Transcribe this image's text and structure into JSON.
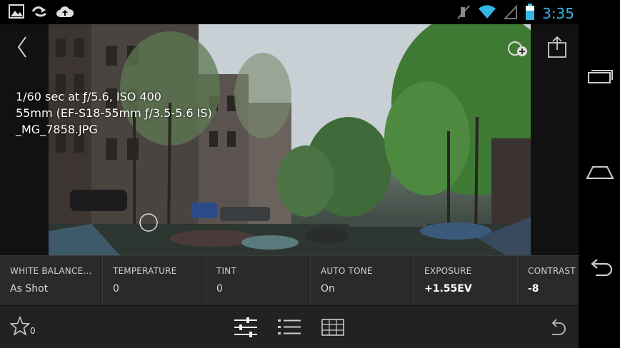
{
  "status_bar": {
    "time": "3:35",
    "left_icons": [
      "image-icon",
      "sync-icon",
      "cloud-upload-icon"
    ],
    "right_icons": [
      "mute-icon",
      "wifi-icon",
      "signal-icon",
      "battery-icon"
    ],
    "time_color": "#33b5e5"
  },
  "photo_info": {
    "exposure_line": "1/60 sec at ƒ/5.6, ISO 400",
    "lens_line": "55mm (EF-S18-55mm ƒ/3.5-5.6 IS)",
    "filename": "_MG_7858.JPG"
  },
  "adjustments": [
    {
      "label": "WHITE BALANCE...",
      "value": "As Shot",
      "bold": false
    },
    {
      "label": "TEMPERATURE",
      "value": "0",
      "bold": false
    },
    {
      "label": "TINT",
      "value": "0",
      "bold": false
    },
    {
      "label": "AUTO TONE",
      "value": "On",
      "bold": false
    },
    {
      "label": "EXPOSURE",
      "value": "+1.55EV",
      "bold": true
    },
    {
      "label": "CONTRAST",
      "value": "-8",
      "bold": true
    }
  ],
  "toolbar": {
    "rating_count": "0",
    "icons": [
      "star-icon",
      "adjust-sliders-icon",
      "presets-list-icon",
      "crop-grid-icon",
      "undo-icon"
    ]
  },
  "nav_bar": {
    "icons": [
      "recent-apps-icon",
      "home-icon",
      "back-icon"
    ]
  }
}
